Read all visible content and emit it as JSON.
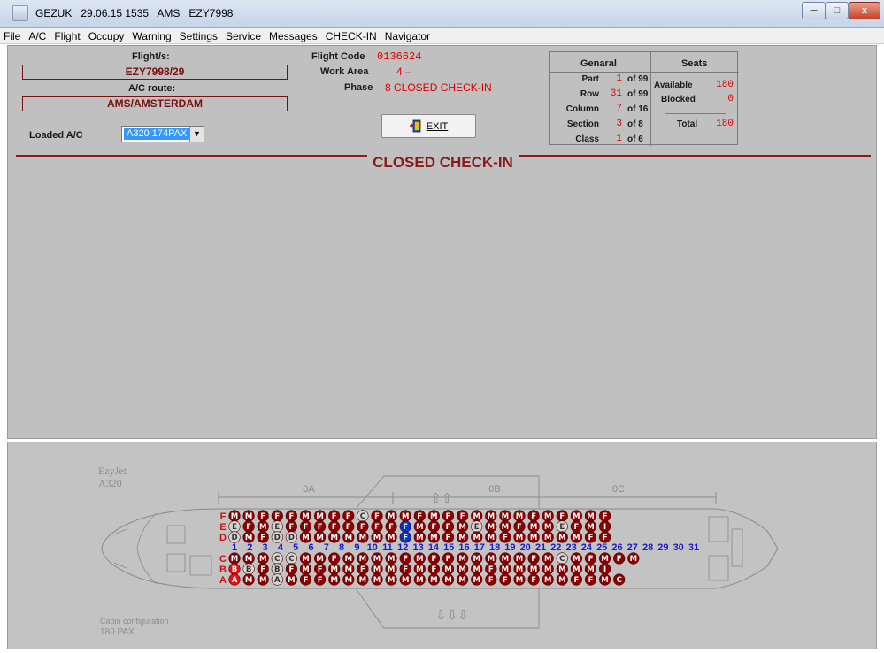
{
  "window": {
    "title": "GEZUK   29.06.15 1535   AMS   EZY7998",
    "buttons": {
      "minimize": "─",
      "maximize": "□",
      "close": "x"
    }
  },
  "menu": [
    {
      "label": "File"
    },
    {
      "label": "A/C"
    },
    {
      "label": "Flight"
    },
    {
      "label": "Occupy"
    },
    {
      "label": "Warning"
    },
    {
      "label": "Settings"
    },
    {
      "label": "Service"
    },
    {
      "label": "Messages"
    },
    {
      "label": "CHECK-IN"
    },
    {
      "label": "Navigator"
    }
  ],
  "flight": {
    "flights_label": "Flight/s:",
    "flights_value": "EZY7998/29",
    "route_label": "A/C route:",
    "route_value": "AMS/AMSTERDAM",
    "loaded_label": "Loaded A/C",
    "loaded_value": "A320 174PAX",
    "flight_code_label": "Flight Code",
    "flight_code": "0136624",
    "work_area_label": "Work Area",
    "work_area": "4 –",
    "phase_label": "Phase",
    "phase": "8 CLOSED CHECK-IN",
    "exit_label": "EXIT"
  },
  "stats": {
    "general_title": "Genaral",
    "seats_title": "Seats",
    "of_label": "of",
    "rows": [
      {
        "label": "Part",
        "value": "1",
        "total": "99"
      },
      {
        "label": "Row",
        "value": "31",
        "total": "99"
      },
      {
        "label": "Column",
        "value": "7",
        "total": "16"
      },
      {
        "label": "Section",
        "value": "3",
        "total": "8"
      },
      {
        "label": "Class",
        "value": "1",
        "total": "6"
      }
    ],
    "seats": [
      {
        "label": "Available",
        "value": "180"
      },
      {
        "label": "Blocked",
        "value": "0"
      },
      {
        "label": "Total",
        "value": "180"
      }
    ]
  },
  "status_heading": "CLOSED CHECK-IN",
  "seat_map": {
    "airline": "EzyJet",
    "aircraft": "A320",
    "sections": [
      "0A",
      "0B",
      "0C"
    ],
    "cabin_config_label": "Cabin configuration",
    "cabin_config_value": "180 PAX",
    "row_letters_upper": [
      "F",
      "E",
      "D"
    ],
    "row_letters_lower": [
      "C",
      "B",
      "A"
    ],
    "row_numbers": [
      "1",
      "2",
      "3",
      "4",
      "5",
      "6",
      "7",
      "8",
      "9",
      "10",
      "11",
      "12",
      "13",
      "14",
      "15",
      "16",
      "17",
      "18",
      "19",
      "20",
      "21",
      "22",
      "23",
      "24",
      "25",
      "26",
      "27",
      "28",
      "29",
      "30",
      "31"
    ],
    "colors": {
      "occupied": "#8b0000",
      "free": "#d4d4d4",
      "selected": "#0033cc",
      "bright": "#e81010",
      "rownum": "#1a1acc",
      "letter": "#cc1010"
    },
    "seats": {
      "F": "MMFFFMMFFCFMMFMFFMMMMFMFMMF",
      "E": "EFMEFFFFFFFFFMFFMEMMFMMEFMI",
      "D": "DMFDDMMMMMMMFMMFMMMFMMMMMFF",
      "C": "MMMCCMMFMMMMFMFFMMMMMFMCMFMFM",
      "B": "BBFBFMFMMFMMFMFMMMFMMMMMMMI",
      "A": "AMMAMFFMMMMMMMMMMMFFMFMMFFMC"
    }
  }
}
